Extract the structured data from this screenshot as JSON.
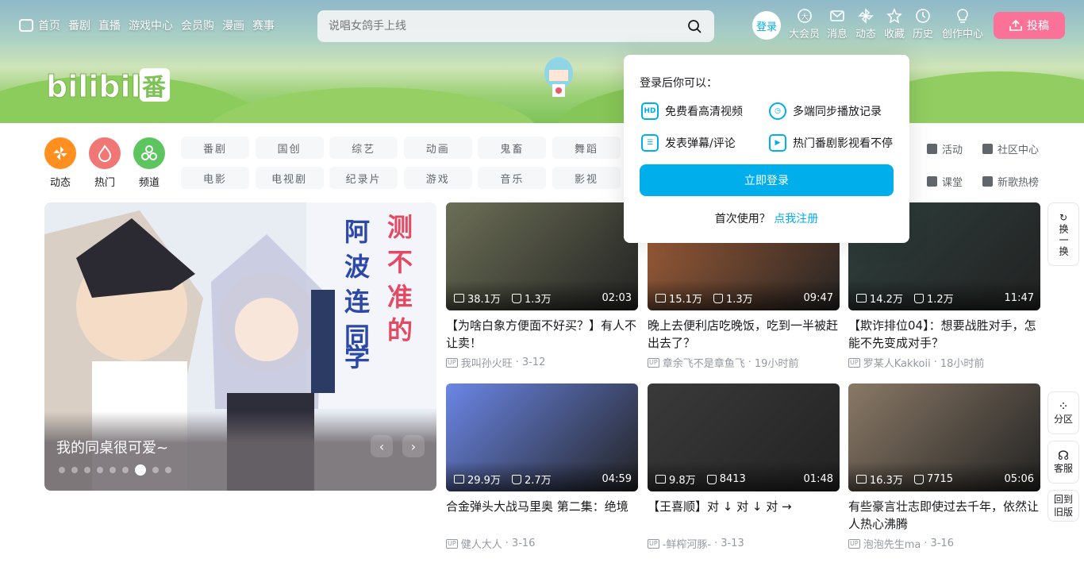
{
  "nav": {
    "left": [
      "首页",
      "番剧",
      "直播",
      "游戏中心",
      "会员购",
      "漫画",
      "赛事"
    ],
    "search_placeholder": "说唱女鸽手上线",
    "login": "登录",
    "right": [
      "大会员",
      "消息",
      "动态",
      "收藏",
      "历史",
      "创作中心"
    ],
    "upload": "投稿"
  },
  "categories": {
    "icons": [
      {
        "label": "动态",
        "color": "#ff8f1f"
      },
      {
        "label": "热门",
        "color": "#f07775"
      },
      {
        "label": "频道",
        "color": "#5dc55f"
      }
    ],
    "chips": [
      "番剧",
      "国创",
      "综艺",
      "动画",
      "鬼畜",
      "舞蹈",
      "电影",
      "电视剧",
      "纪录片",
      "游戏",
      "音乐",
      "影视"
    ],
    "side_links": [
      "活动",
      "社区中心",
      "课堂",
      "新歌热榜"
    ]
  },
  "carousel": {
    "title": "我的同桌很可爱~",
    "dots": 9,
    "active_dot": 6
  },
  "videos": [
    {
      "views": "38.1万",
      "likes": "1.3万",
      "duration": "02:03",
      "title": "【为啥白象方便面不好买？】有人不让卖！",
      "author": "我叫孙火旺",
      "date": "3-12",
      "color": "#6c6f56"
    },
    {
      "views": "15.1万",
      "likes": "1.3万",
      "duration": "09:47",
      "title": "晚上去便利店吃晚饭，吃到一半被赶出去了？",
      "author": "章余飞不是章鱼飞",
      "date": "19小时前",
      "color": "#a9623a"
    },
    {
      "views": "14.2万",
      "likes": "1.2万",
      "duration": "11:47",
      "title": "【欺诈排位04】：想要战胜对手，怎能不先变成对手？",
      "author": "罗某人Kakkoii",
      "date": "18小时前",
      "color": "#2e3f3c"
    },
    {
      "views": "29.9万",
      "likes": "2.7万",
      "duration": "04:59",
      "title": "合金弹头大战马里奥 第二集：绝境",
      "author": "健人大人",
      "date": "3-16",
      "color": "#6b86e6"
    },
    {
      "views": "9.8万",
      "likes": "8413",
      "duration": "01:48",
      "title": "【王喜顺】对 ↓ 对 ↓ 对 →",
      "author": "-鲜榨河豚-",
      "date": "3-13",
      "color": "#3a3a3a"
    },
    {
      "views": "16.3万",
      "likes": "7715",
      "duration": "05:06",
      "title": "有些豪言壮志即使过去千年，依然让人热心沸腾",
      "author": "泡泡先生ma",
      "date": "3-16",
      "color": "#8a7966"
    }
  ],
  "popup": {
    "header": "登录后你可以：",
    "items": [
      {
        "icon": "HD",
        "label": "免费看高清视频"
      },
      {
        "icon": "clock",
        "label": "多端同步播放记录"
      },
      {
        "icon": "list",
        "label": "发表弹幕/评论"
      },
      {
        "icon": "play",
        "label": "热门番剧影视看不停"
      }
    ],
    "button": "立即登录",
    "register_prefix": "首次使用？",
    "register_link": "点我注册"
  },
  "float_buttons": {
    "refresh": "换一换",
    "zone": "分区",
    "service": "客服",
    "old": "回到旧版"
  }
}
